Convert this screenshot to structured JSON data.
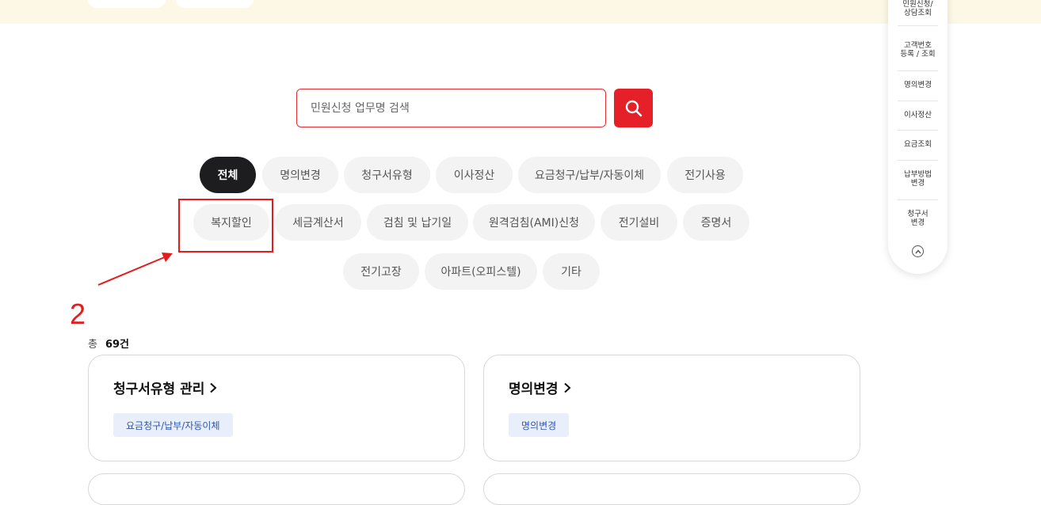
{
  "search": {
    "placeholder": "민원신청 업무명 검색"
  },
  "categories": [
    {
      "label": "전체",
      "active": true
    },
    {
      "label": "명의변경"
    },
    {
      "label": "청구서유형"
    },
    {
      "label": "이사정산"
    },
    {
      "label": "요금청구/납부/자동이체"
    },
    {
      "label": "전기사용"
    },
    {
      "label": "복지할인"
    },
    {
      "label": "세금계산서"
    },
    {
      "label": "검침 및 납기일"
    },
    {
      "label": "원격검침(AMI)신청"
    },
    {
      "label": "전기설비"
    },
    {
      "label": "증명서"
    },
    {
      "label": "전기고장"
    },
    {
      "label": "아파트(오피스텔)"
    },
    {
      "label": "기타"
    }
  ],
  "annotation": {
    "number": "2"
  },
  "results": {
    "total_label": "총",
    "total_count": "69건"
  },
  "cards": [
    {
      "title": "청구서유형 관리",
      "tag": "요금청구/납부/자동이체"
    },
    {
      "title": "명의변경",
      "tag": "명의변경"
    }
  ],
  "quick_menu": {
    "items": [
      "민원신청/\n상담조회",
      "고객번호\n등록 / 조회",
      "명의변경",
      "이사정산",
      "요금조회",
      "납부방법\n변경",
      "청구서\n변경"
    ]
  },
  "colors": {
    "accent": "#e52029",
    "active_chip": "#1d1d1f",
    "tag_bg": "#e9effa",
    "tag_text": "#2d56b8",
    "annotation": "#e41c1c"
  }
}
